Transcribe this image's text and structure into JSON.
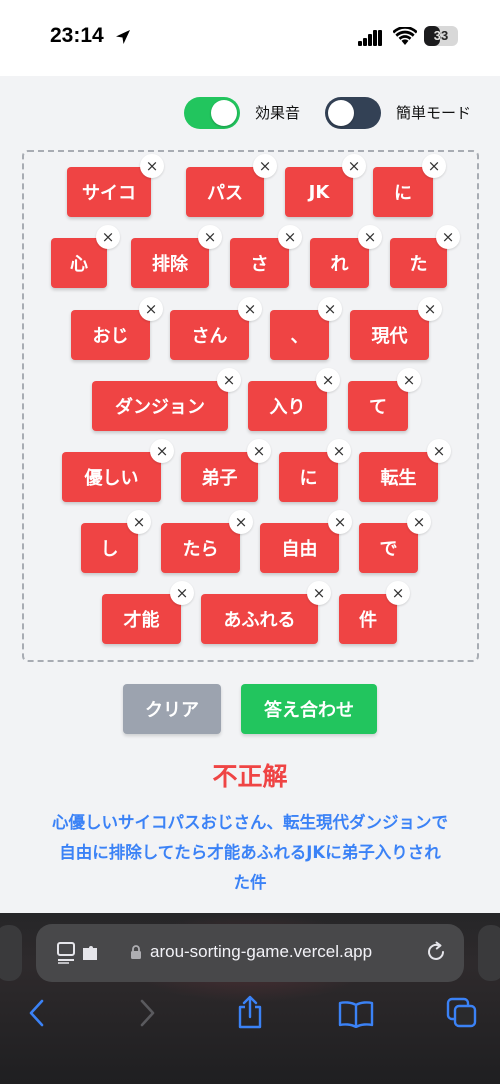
{
  "status": {
    "time": "23:14",
    "battery": "33"
  },
  "toggles": [
    {
      "label": "効果音",
      "on": true,
      "color": "#22c55e"
    },
    {
      "label": "簡単モード",
      "on": false,
      "color": "#334155"
    }
  ],
  "tiles": [
    {
      "text": "サイコ"
    },
    {
      "text": "パス"
    },
    {
      "text": "JK"
    },
    {
      "text": "に"
    },
    {
      "text": "心"
    },
    {
      "text": "排除"
    },
    {
      "text": "さ"
    },
    {
      "text": "れ"
    },
    {
      "text": "た"
    },
    {
      "text": "おじ"
    },
    {
      "text": "さん"
    },
    {
      "text": "、"
    },
    {
      "text": "現代"
    },
    {
      "text": "ダンジョン"
    },
    {
      "text": "入り"
    },
    {
      "text": "て"
    },
    {
      "text": "優しい"
    },
    {
      "text": "弟子"
    },
    {
      "text": "に"
    },
    {
      "text": "転生"
    },
    {
      "text": "し"
    },
    {
      "text": "たら"
    },
    {
      "text": "自由"
    },
    {
      "text": "で"
    },
    {
      "text": "才能"
    },
    {
      "text": "あふれる"
    },
    {
      "text": "件"
    }
  ],
  "tile_remove_glyph": "×",
  "buttons": {
    "clear": "クリア",
    "check": "答え合わせ"
  },
  "result": "不正解",
  "answer_lines": [
    "心優しいサイコパスおじさん、転生現代ダンジョンで",
    "自由に排除してたら才能あふれるJKに弟子入りされ",
    "た件"
  ],
  "browser": {
    "url": "arou-sorting-game.vercel.app"
  },
  "colors": {
    "tile": "#ef4444",
    "result": "#ef4444",
    "answer": "#3b82f6",
    "clear": "#9ca3af",
    "check": "#22c55e",
    "toolbar_icon": "#3b82f6"
  }
}
